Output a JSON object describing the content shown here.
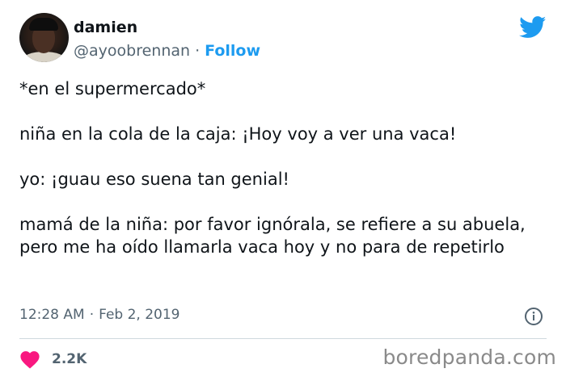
{
  "author": {
    "display_name": "damien",
    "handle": "@ayoobrennan",
    "separator": "·",
    "follow_label": "Follow"
  },
  "tweet": {
    "lines": [
      "*en el supermercado*",
      "niña en la cola de la caja: ¡Hoy voy a ver una vaca!",
      "yo: ¡guau eso suena tan genial!",
      "mamá de la niña: por favor ignórala, se refiere a su abuela, pero me ha oído llamarla vaca hoy y no para de repetirlo"
    ],
    "time": "12:28 AM",
    "separator": "·",
    "date": "Feb 2, 2019"
  },
  "engagement": {
    "likes": "2.2K"
  },
  "watermark": "boredpanda.com",
  "icons": {
    "brand": "twitter-bird-icon",
    "info": "info-icon",
    "like": "heart-icon"
  },
  "colors": {
    "accent": "#1d9bf0",
    "heart": "#f91880",
    "muted": "#536471",
    "text": "#0f1419"
  }
}
